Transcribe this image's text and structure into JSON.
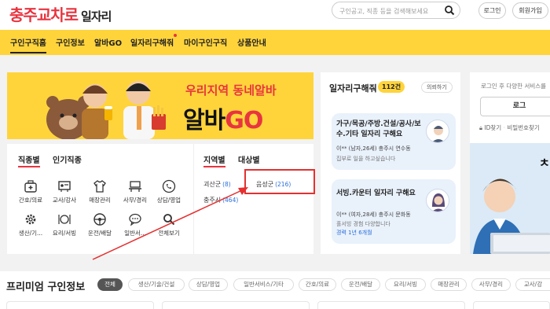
{
  "header": {
    "logo_main": "충주",
    "logo_accent": "교차로",
    "logo_sub": "일자리",
    "search_placeholder": "구인공고, 직종 등을 검색해보세요",
    "login_label": "로그인",
    "signup_label": "회원가입"
  },
  "nav": {
    "items": [
      {
        "label": "구인구직홈"
      },
      {
        "label": "구인정보"
      },
      {
        "label": "알바GO"
      },
      {
        "label": "일자리구해줘"
      },
      {
        "label": "마이구인구직"
      },
      {
        "label": "상품안내"
      }
    ]
  },
  "banner": {
    "top_text": "우리지역 동네알바",
    "main_text": "알바",
    "main_accent": "GO"
  },
  "category": {
    "tabs": [
      {
        "label": "직종별"
      },
      {
        "label": "인기직종"
      }
    ],
    "items": [
      {
        "label": "간호/의료",
        "icon": "medical-kit-icon"
      },
      {
        "label": "교사/강사",
        "icon": "teacher-board-icon"
      },
      {
        "label": "매장관리",
        "icon": "shirt-icon"
      },
      {
        "label": "사무/경리",
        "icon": "desk-icon"
      },
      {
        "label": "상담/영업",
        "icon": "phone-icon"
      },
      {
        "label": "생산/기...",
        "icon": "gear-icon"
      },
      {
        "label": "요리/서빙",
        "icon": "dish-icon"
      },
      {
        "label": "운전/배달",
        "icon": "steering-wheel-icon"
      },
      {
        "label": "일반서...",
        "icon": "chat-icon"
      },
      {
        "label": "전체보기",
        "icon": "search-icon"
      }
    ],
    "region_tabs": [
      {
        "label": "지역별"
      },
      {
        "label": "대상별"
      }
    ],
    "regions": [
      {
        "name": "괴산군",
        "count": "(8)"
      },
      {
        "name": "음성군",
        "count": "(216)"
      },
      {
        "name": "충주시",
        "count": "(464)"
      }
    ]
  },
  "job_requests": {
    "title": "일자리구해줘",
    "count": "112건",
    "more_label": "의뢰하기",
    "cards": [
      {
        "title": "가구/목공/주방.건설/공사/보수.기타 일자리 구해요",
        "meta": "이** (남자,26세)  충주시 연수동",
        "note": "집부로 일을 하고싶습니다",
        "note_highlight": ""
      },
      {
        "title": "서빙.카운터 일자리 구해요",
        "meta": "이** (여자,28세)  충주시 문화동",
        "note": "홀서빙 경험 다양합니다",
        "note_highlight": "경력 1년 6개월"
      }
    ]
  },
  "login": {
    "desc": "로그인 후 다양한 서비스를",
    "button_label": "로그",
    "id_find": "ID찾기",
    "pw_find": "비밀번호찾기"
  },
  "premium": {
    "title": "프리미엄 구인정보",
    "chips": [
      {
        "label": "전체"
      },
      {
        "label": "생산/기술/건설"
      },
      {
        "label": "상담/영업"
      },
      {
        "label": "일반서비스/기타"
      },
      {
        "label": "간호/의료"
      },
      {
        "label": "운전/배달"
      },
      {
        "label": "요리/서빙"
      },
      {
        "label": "매장관리"
      },
      {
        "label": "사무/경리"
      },
      {
        "label": "교사/강"
      }
    ]
  },
  "colors": {
    "brand_red": "#e8343f",
    "brand_yellow": "#ffd43b",
    "link_blue": "#2a6fdb",
    "highlight_box": "#e53030",
    "arrow": "#e53030"
  }
}
